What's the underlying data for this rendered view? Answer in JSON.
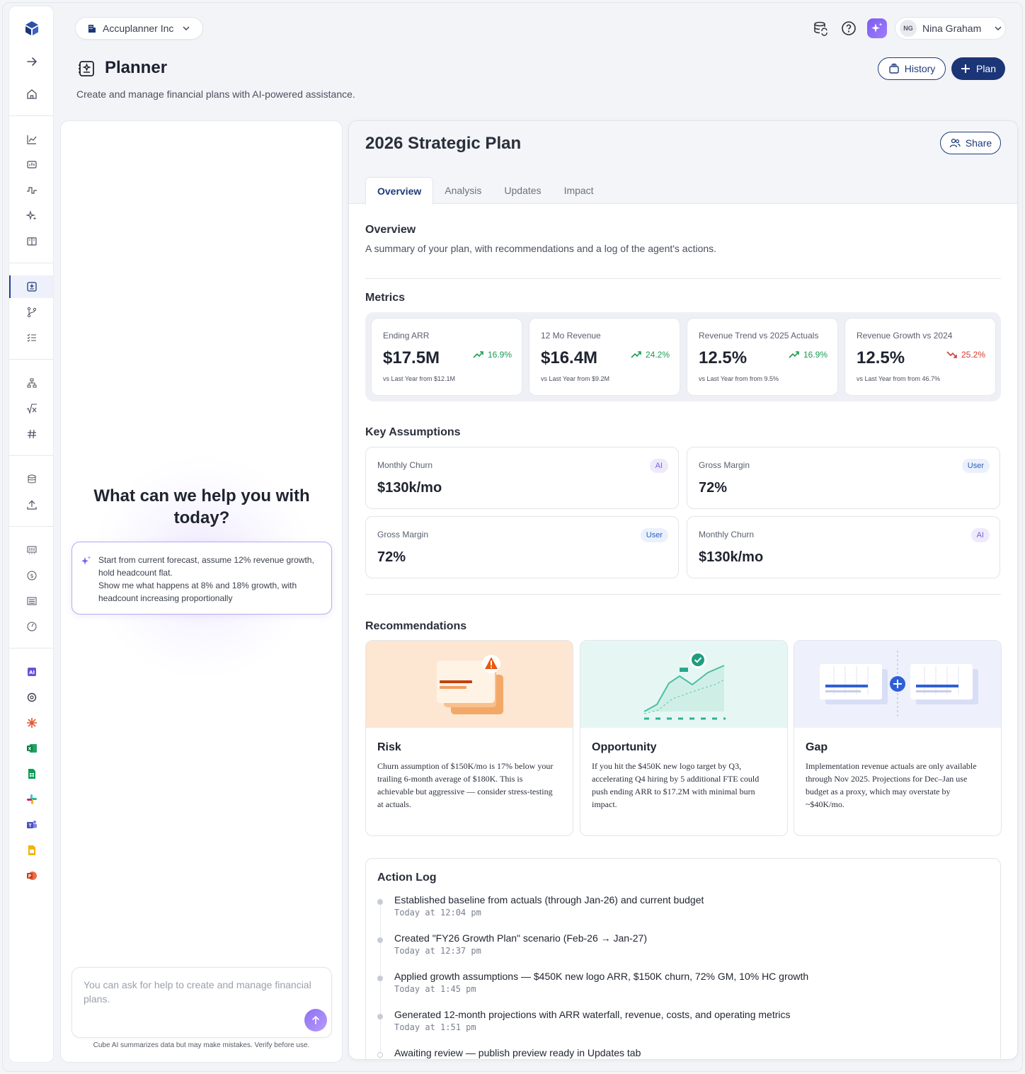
{
  "org": {
    "name": "Accuplanner Inc"
  },
  "user": {
    "initials": "NG",
    "name": "Nina Graham"
  },
  "page": {
    "title": "Planner",
    "subtitle": "Create and manage financial plans with AI-powered assistance.",
    "history_label": "History",
    "plan_label": "Plan"
  },
  "chat": {
    "heading": "What can we help you with today?",
    "prompt_line1": "Start from current forecast, assume 12% revenue growth, hold headcount flat.",
    "prompt_line2": "Show me what happens at 8% and 18% growth, with headcount increasing proportionally",
    "input_placeholder": "You can ask for help to create and manage financial plans.",
    "disclaimer": "Cube AI summarizes data but may make mistakes. Verify before use."
  },
  "plan": {
    "title": "2026 Strategic Plan",
    "share_label": "Share",
    "tabs": [
      "Overview",
      "Analysis",
      "Updates",
      "Impact"
    ],
    "active_tab": "Overview",
    "overview_title": "Overview",
    "overview_sub": "A summary of your plan, with recommendations and a log of the agent's actions.",
    "metrics_title": "Metrics",
    "metrics": [
      {
        "label": "Ending ARR",
        "value": "$17.5M",
        "delta": "16.9%",
        "direction": "up",
        "sub": "vs Last Year from $12.1M"
      },
      {
        "label": "12 Mo Revenue",
        "value": "$16.4M",
        "delta": "24.2%",
        "direction": "up",
        "sub": "vs Last Year from $9.2M"
      },
      {
        "label": "Revenue Trend vs 2025 Actuals",
        "value": "12.5%",
        "delta": "16.9%",
        "direction": "up",
        "sub": "vs Last Year from from 9.5%"
      },
      {
        "label": "Revenue Growth vs 2024",
        "value": "12.5%",
        "delta": "25.2%",
        "direction": "down",
        "sub": "vs Last Year from from 46.7%"
      }
    ],
    "assumptions_title": "Key Assumptions",
    "assumptions": [
      {
        "label": "Monthly Churn",
        "value": "$130k/mo",
        "source": "AI"
      },
      {
        "label": "Gross Margin",
        "value": "72%",
        "source": "User"
      },
      {
        "label": "Gross Margin",
        "value": "72%",
        "source": "User"
      },
      {
        "label": "Monthly Churn",
        "value": "$130k/mo",
        "source": "AI"
      }
    ],
    "recommendations_title": "Recommendations",
    "recommendations": [
      {
        "title": "Risk",
        "body": "Churn assumption of $150K/mo is 17% below your trailing 6-month average of $180K. This is achievable but aggressive — consider stress-testing at actuals."
      },
      {
        "title": "Opportunity",
        "body": "If you hit the $450K new logo target by Q3, accelerating Q4 hiring by 5 additional FTE could push ending ARR to $17.2M with minimal burn impact."
      },
      {
        "title": "Gap",
        "body": "Implementation revenue actuals are only available through Nov 2025. Projections for Dec–Jan use budget as a proxy, which may overstate by ~$40K/mo."
      }
    ],
    "action_log_title": "Action Log",
    "action_log": [
      {
        "text": "Established baseline from actuals (through Jan-26) and current budget",
        "time": "Today at 12:04 pm"
      },
      {
        "text": "Created \"FY26 Growth Plan\" scenario (Feb-26 → Jan-27)",
        "time": "Today at 12:37 pm"
      },
      {
        "text": "Applied growth assumptions — $450K new logo ARR, $150K churn, 72% GM, 10% HC growth",
        "time": "Today at 1:45 pm"
      },
      {
        "text": "Generated 12-month projections with ARR waterfall, revenue, costs, and operating metrics",
        "time": "Today at 1:51 pm"
      },
      {
        "text": "Awaiting review — publish preview ready in Updates tab",
        "time": ""
      }
    ]
  },
  "colors": {
    "brand_navy": "#1c3577",
    "ai_purple": "#7b5cf0",
    "positive": "#1f9a55",
    "negative": "#d23b2e"
  }
}
